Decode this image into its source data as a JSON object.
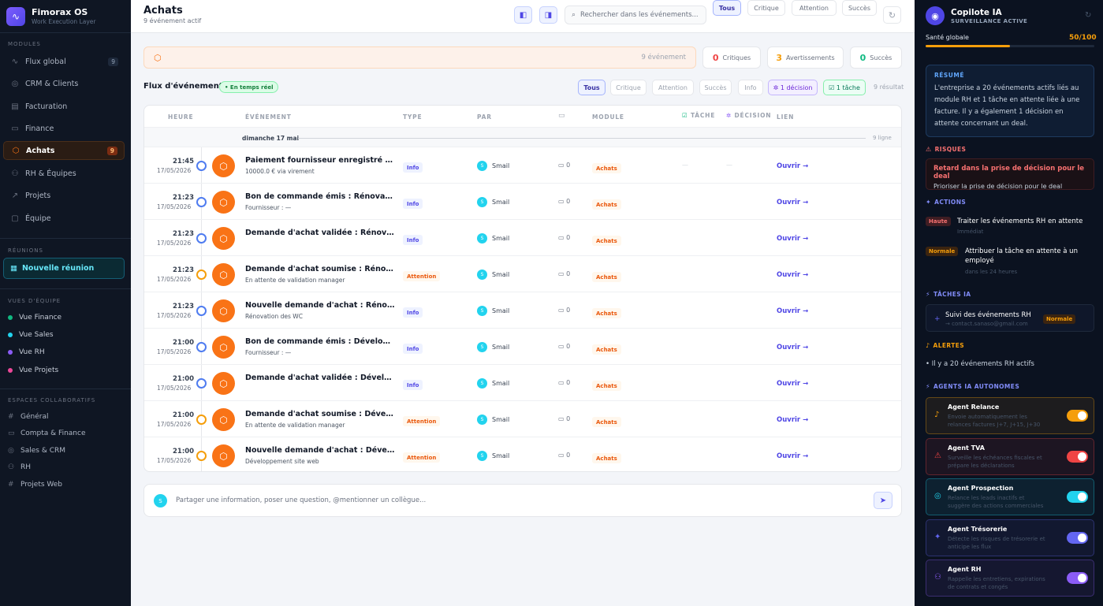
{
  "sidebar": {
    "brand": {
      "name": "Fimorax OS",
      "subtitle": "Work Execution Layer"
    },
    "sections": {
      "modules": "MODULES",
      "meetings": "RÉUNIONS",
      "team_views": "VUES D'ÉQUIPE",
      "workspaces": "ESPACES COLLABORATIFS"
    },
    "modules": [
      {
        "label": "Flux global",
        "icon": "activity-icon",
        "count": "9"
      },
      {
        "label": "CRM & Clients",
        "icon": "target-icon",
        "count": ""
      },
      {
        "label": "Facturation",
        "icon": "invoice-icon",
        "count": ""
      },
      {
        "label": "Finance",
        "icon": "banknote-icon",
        "count": ""
      },
      {
        "label": "Achats",
        "icon": "box-icon",
        "count": "9",
        "active": true
      },
      {
        "label": "RH & Équipes",
        "icon": "users-icon",
        "count": ""
      },
      {
        "label": "Projets",
        "icon": "trend-icon",
        "count": ""
      },
      {
        "label": "Équipe",
        "icon": "chat-icon",
        "count": ""
      }
    ],
    "new_meeting": "Nouvelle réunion",
    "team_views": [
      {
        "label": "Vue Finance",
        "color": "#10b981"
      },
      {
        "label": "Vue Sales",
        "color": "#22d3ee"
      },
      {
        "label": "Vue RH",
        "color": "#8b5cf6"
      },
      {
        "label": "Vue Projets",
        "color": "#ec4899"
      }
    ],
    "workspaces": [
      {
        "label": "Général",
        "icon": "hash-icon"
      },
      {
        "label": "Compta & Finance",
        "icon": "banknote-icon"
      },
      {
        "label": "Sales & CRM",
        "icon": "target-icon"
      },
      {
        "label": "RH",
        "icon": "users-icon"
      },
      {
        "label": "Projets Web",
        "icon": "hash-icon"
      }
    ]
  },
  "header": {
    "title": "Achats",
    "subtitle": "9 événement actif",
    "search_placeholder": "Rechercher dans les événements...",
    "filters": [
      "Tous",
      "Critique",
      "Attention",
      "Succès"
    ],
    "selected_filter": "Tous"
  },
  "banner": {
    "text": "9 événement"
  },
  "stats": [
    {
      "value": "0",
      "label": "Critiques",
      "color": "#ef4444"
    },
    {
      "value": "3",
      "label": "Avertissements",
      "color": "#f59e0b"
    },
    {
      "value": "0",
      "label": "Succès",
      "color": "#10b981"
    }
  ],
  "feed": {
    "title": "Flux d'événements",
    "live": "En temps réel",
    "filters": [
      "Tous",
      "Critique",
      "Attention",
      "Succès",
      "Info"
    ],
    "decision_chip": "1 décision",
    "task_chip": "1 tâche",
    "results": "9 résultat"
  },
  "table": {
    "columns": {
      "time": "HEURE",
      "event": "ÉVÉNEMENT",
      "type": "TYPE",
      "by": "PAR",
      "module": "MODULE",
      "task": "TÂCHE",
      "decision": "DÉCISION",
      "link": "LIEN"
    },
    "day": {
      "label": "dimanche 17 mai",
      "count": "9 ligne"
    },
    "rows": [
      {
        "time": "21:45",
        "date": "17/05/2026",
        "title": "Paiement fournisseur enregistré : Développement site web",
        "sub": "10000.0 € via virement",
        "type": "Info",
        "level": "info",
        "by": "Smail",
        "comments": "0",
        "module": "Achats",
        "task": "—",
        "decision": "—",
        "link": "Ouvrir →"
      },
      {
        "time": "21:23",
        "date": "17/05/2026",
        "title": "Bon de commande émis : Rénovation des WC",
        "sub": "Fournisseur : —",
        "type": "Info",
        "level": "info",
        "by": "Smail",
        "comments": "0",
        "module": "Achats",
        "task": "",
        "decision": "",
        "link": "Ouvrir →"
      },
      {
        "time": "21:23",
        "date": "17/05/2026",
        "title": "Demande d'achat validée : Rénovation des WC",
        "sub": "",
        "type": "Info",
        "level": "info",
        "by": "Smail",
        "comments": "0",
        "module": "Achats",
        "task": "",
        "decision": "",
        "link": "Ouvrir →"
      },
      {
        "time": "21:23",
        "date": "17/05/2026",
        "title": "Demande d'achat soumise : Rénovation des WC",
        "sub": "En attente de validation manager",
        "type": "Attention",
        "level": "warn",
        "by": "Smail",
        "comments": "0",
        "module": "Achats",
        "task": "",
        "decision": "",
        "link": "Ouvrir →"
      },
      {
        "time": "21:23",
        "date": "17/05/2026",
        "title": "Nouvelle demande d'achat : Rénovation des WC",
        "sub": "Rénovation des WC",
        "type": "Info",
        "level": "info",
        "by": "Smail",
        "comments": "0",
        "module": "Achats",
        "task": "",
        "decision": "",
        "link": "Ouvrir →"
      },
      {
        "time": "21:00",
        "date": "17/05/2026",
        "title": "Bon de commande émis : Développement site web",
        "sub": "Fournisseur : —",
        "type": "Info",
        "level": "info",
        "by": "Smail",
        "comments": "0",
        "module": "Achats",
        "task": "",
        "decision": "",
        "link": "Ouvrir →"
      },
      {
        "time": "21:00",
        "date": "17/05/2026",
        "title": "Demande d'achat validée : Développement site web",
        "sub": "",
        "type": "Info",
        "level": "info",
        "by": "Smail",
        "comments": "0",
        "module": "Achats",
        "task": "",
        "decision": "",
        "link": "Ouvrir →"
      },
      {
        "time": "21:00",
        "date": "17/05/2026",
        "title": "Demande d'achat soumise : Développement site web",
        "sub": "En attente de validation manager",
        "type": "Attention",
        "level": "warn",
        "by": "Smail",
        "comments": "0",
        "module": "Achats",
        "task": "",
        "decision": "",
        "link": "Ouvrir →"
      },
      {
        "time": "21:00",
        "date": "17/05/2026",
        "title": "Nouvelle demande d'achat : Développement site web",
        "sub": "Développement site web",
        "type": "Attention",
        "level": "warn",
        "by": "Smail",
        "comments": "0",
        "module": "Achats",
        "task": "",
        "decision": "",
        "link": "Ouvrir →"
      }
    ]
  },
  "composer": {
    "placeholder": "Partager une information, poser une question, @mentionner un collègue..."
  },
  "copilot": {
    "title": "Copilote IA",
    "status": "SURVEILLANCE ACTIVE",
    "health_label": "Santé globale",
    "health_value": "50/100",
    "health_pct": 50,
    "resume_title": "RÉSUMÉ",
    "resume_text": "L'entreprise a 20 événements actifs liés au module RH et 1 tâche en attente liée à une facture. Il y a également 1 décision en attente concernant un deal.",
    "risks_title": "RISQUES",
    "risk": {
      "title": "Retard dans la prise de décision pour le deal",
      "sub": "Prioriser la prise de décision pour le deal"
    },
    "actions_title": "ACTIONS",
    "actions": [
      {
        "badge": "Haute",
        "title": "Traiter les événements RH en attente",
        "sub": "Immédiat"
      },
      {
        "badge": "Normale",
        "title": "Attribuer la tâche en attente à un employé",
        "sub": "dans les 24 heures"
      }
    ],
    "tasks_title": "TÂCHES IA",
    "task": {
      "title": "Suivi des événements RH",
      "sub": "→ contact.sanaso@gmail.com",
      "badge": "Normale"
    },
    "alerts_title": "ALERTES",
    "alert": "• Il y a 20 événements RH actifs",
    "agents_title": "AGENTS IA AUTONOMES",
    "agents": [
      {
        "name": "Agent Relance",
        "desc": "Envoie automatiquement les relances factures J+7, J+15, J+30",
        "color": "#f59e0b",
        "icon": "bell-icon"
      },
      {
        "name": "Agent TVA",
        "desc": "Surveille les échéances fiscales et prépare les déclarations",
        "color": "#ef4444",
        "icon": "warning-icon"
      },
      {
        "name": "Agent Prospection",
        "desc": "Relance les leads inactifs et suggère des actions commerciales",
        "color": "#22d3ee",
        "icon": "target-icon"
      },
      {
        "name": "Agent Trésorerie",
        "desc": "Détecte les risques de trésorerie et anticipe les flux",
        "color": "#6366f1",
        "icon": "sparkle-icon"
      },
      {
        "name": "Agent RH",
        "desc": "Rappelle les entretiens, expirations de contrats et congés",
        "color": "#8b5cf6",
        "icon": "users-icon"
      }
    ]
  }
}
